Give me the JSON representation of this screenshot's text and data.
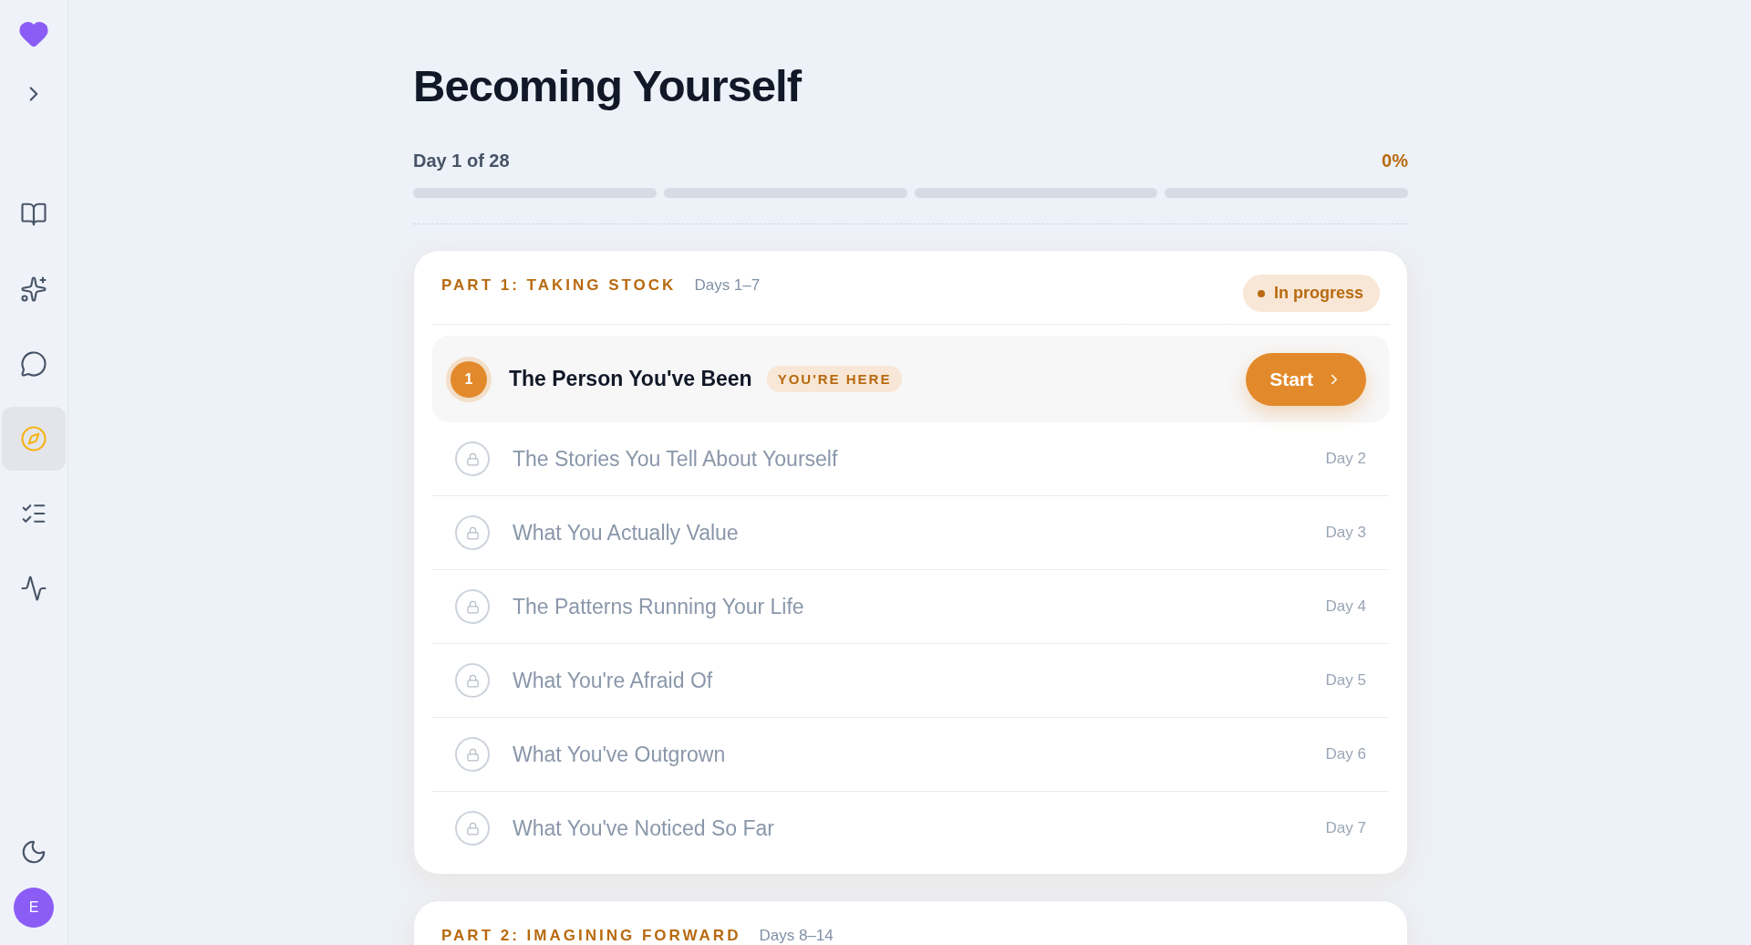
{
  "sidebar": {
    "items": [
      {
        "kind": "book",
        "selected": false
      },
      {
        "kind": "sparkles",
        "selected": false
      },
      {
        "kind": "chat",
        "selected": false
      },
      {
        "kind": "compass",
        "selected": true
      },
      {
        "kind": "checklist",
        "selected": false
      },
      {
        "kind": "pulse",
        "selected": false
      }
    ],
    "avatar": "E"
  },
  "title": "Becoming Yourself",
  "progress": {
    "label": "Day 1 of 28",
    "percent": "0%",
    "segments": [
      {
        "level": 0
      },
      {
        "level": 0
      },
      {
        "level": 0
      },
      {
        "level": 0
      }
    ]
  },
  "parts": [
    {
      "title": "PART 1: TAKING STOCK",
      "days": "Days 1–7",
      "status": "In progress",
      "lessons": [
        {
          "kind": "current",
          "number": "1",
          "title": "The Person You've Been",
          "badge": "YOU'RE HERE",
          "action": "Start"
        },
        {
          "kind": "locked",
          "title": "The Stories You Tell About Yourself",
          "day": "Day 2"
        },
        {
          "kind": "locked",
          "title": "What You Actually Value",
          "day": "Day 3"
        },
        {
          "kind": "locked",
          "title": "The Patterns Running Your Life",
          "day": "Day 4"
        },
        {
          "kind": "locked",
          "title": "What You're Afraid Of",
          "day": "Day 5"
        },
        {
          "kind": "locked",
          "title": "What You've Outgrown",
          "day": "Day 6"
        },
        {
          "kind": "locked",
          "title": "What You've Noticed So Far",
          "day": "Day 7"
        }
      ]
    },
    {
      "title": "PART 2: IMAGINING FORWARD",
      "days": "Days 8–14"
    }
  ]
}
